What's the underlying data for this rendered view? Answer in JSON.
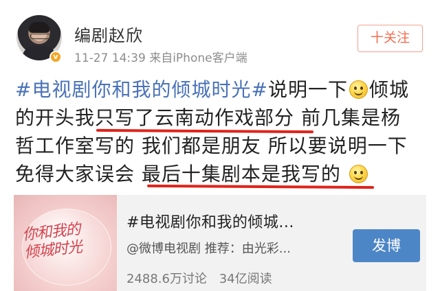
{
  "header": {
    "username": "编剧赵欣",
    "time": "11-27 14:39",
    "source": "来自iPhone客户端",
    "follow_label": "十关注",
    "verified_badge": "v"
  },
  "post": {
    "line1": {
      "topic": "#电视剧你和我的倾城时光#",
      "text_a": "说明一下",
      "text_b": "倾城"
    },
    "line2": {
      "text_a": "的开头",
      "highlight": "我只写了云南动作戏部分",
      "text_b": "前几集是杨"
    },
    "line3": {
      "text": "哲工作室写的 我们都是朋友 所以要说明一下"
    },
    "line4": {
      "text_a": "免得大家误会",
      "highlight": "最后十集剧本是我写的"
    },
    "emoji_name": "smile-emoji",
    "underline_color": "#e0231a",
    "topic_color": "#4a72b7"
  },
  "card": {
    "thumb_text_1": "你和我的",
    "thumb_text_2": "倾城时光",
    "title": "#电视剧你和我的倾城...",
    "subtitle": "@微博电视剧 推荐：由光彩...",
    "discussions": "2488.6万讨论",
    "reads": "34亿阅读",
    "button_label": "发博",
    "button_color": "#4d86c6"
  }
}
